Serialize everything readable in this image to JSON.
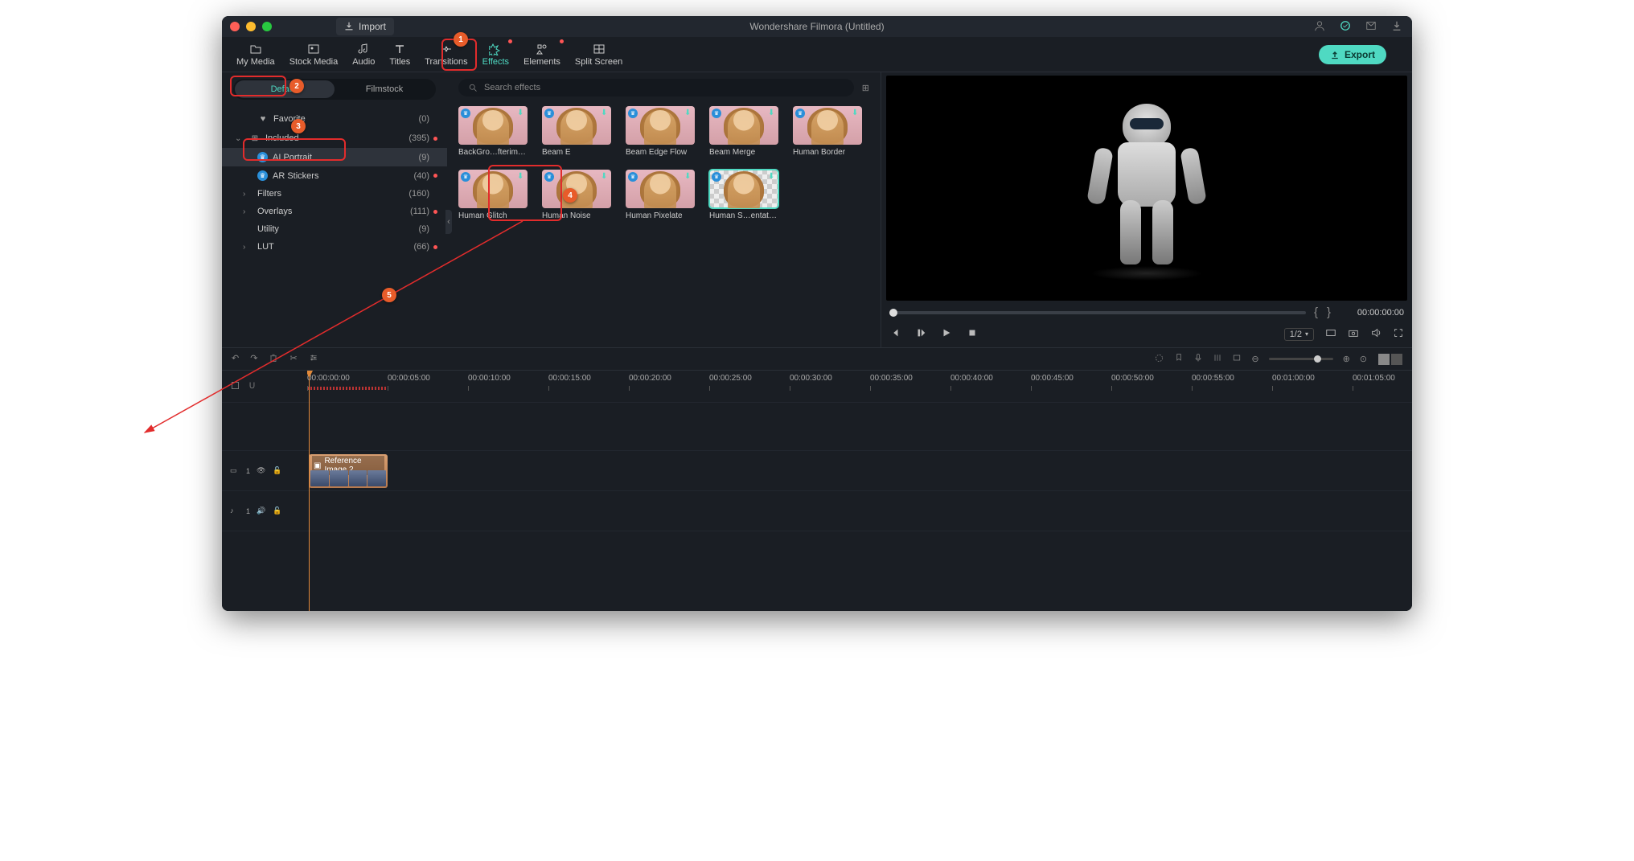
{
  "titlebar": {
    "import": "Import",
    "title": "Wondershare Filmora (Untitled)"
  },
  "nav": [
    {
      "label": "My Media"
    },
    {
      "label": "Stock Media"
    },
    {
      "label": "Audio"
    },
    {
      "label": "Titles"
    },
    {
      "label": "Transitions"
    },
    {
      "label": "Effects",
      "active": true,
      "badge": true
    },
    {
      "label": "Elements",
      "badge": true
    },
    {
      "label": "Split Screen"
    }
  ],
  "export": "Export",
  "subtabs": {
    "default": "Default",
    "filmstock": "Filmstock"
  },
  "tree": {
    "favorite": {
      "label": "Favorite",
      "count": "(0)"
    },
    "included": {
      "label": "Included",
      "count": "(395)",
      "dot": true
    },
    "ai_portrait": {
      "label": "AI Portrait",
      "count": "(9)"
    },
    "ar_stickers": {
      "label": "AR Stickers",
      "count": "(40)",
      "dot": true
    },
    "filters": {
      "label": "Filters",
      "count": "(160)"
    },
    "overlays": {
      "label": "Overlays",
      "count": "(111)",
      "dot": true
    },
    "utility": {
      "label": "Utility",
      "count": "(9)"
    },
    "lut": {
      "label": "LUT",
      "count": "(66)",
      "dot": true
    }
  },
  "search": {
    "placeholder": "Search effects"
  },
  "effects": [
    {
      "label": "BackGro…fterimage"
    },
    {
      "label": "Beam E"
    },
    {
      "label": "Beam Edge Flow"
    },
    {
      "label": "Beam Merge"
    },
    {
      "label": "Human Border"
    },
    {
      "label": "Human Glitch"
    },
    {
      "label": "Human Noise"
    },
    {
      "label": "Human Pixelate"
    },
    {
      "label": "Human S…entation",
      "selected": true,
      "checker": true
    }
  ],
  "preview": {
    "timecode": "00:00:00:00",
    "scale": "1/2"
  },
  "ruler": [
    "00:00:00:00",
    "00:00:05:00",
    "00:00:10:00",
    "00:00:15:00",
    "00:00:20:00",
    "00:00:25:00",
    "00:00:30:00",
    "00:00:35:00",
    "00:00:40:00",
    "00:00:45:00",
    "00:00:50:00",
    "00:00:55:00",
    "00:01:00:00",
    "00:01:05:00"
  ],
  "tracks": {
    "video": {
      "id": "1",
      "clip_label": "Reference Image 2"
    },
    "audio": {
      "id": "1"
    }
  },
  "markers": {
    "1": "1",
    "2": "2",
    "3": "3",
    "4": "4",
    "5": "5"
  }
}
